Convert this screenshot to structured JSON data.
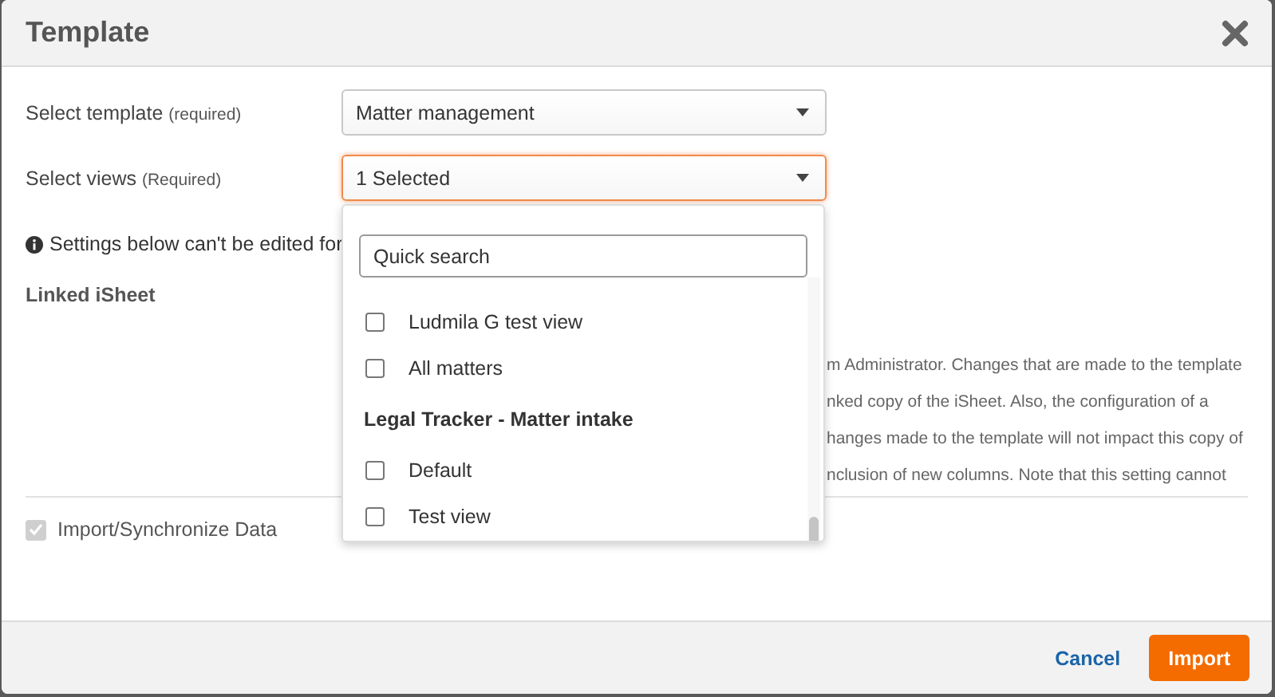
{
  "dialog": {
    "title": "Template"
  },
  "fields": [
    {
      "label": "Select template",
      "hint": "(required)",
      "value": "Matter management",
      "focused": false
    },
    {
      "label": "Select views",
      "hint": "(Required)",
      "value": "1 Selected",
      "focused": true
    }
  ],
  "views_menu": {
    "search_placeholder": "Quick search",
    "items": [
      {
        "kind": "option",
        "label": "Ludmila G test view",
        "checked": false
      },
      {
        "kind": "option",
        "label": "All matters",
        "checked": false
      },
      {
        "kind": "group",
        "label": "Legal Tracker - Matter intake"
      },
      {
        "kind": "option",
        "label": "Default",
        "checked": false
      },
      {
        "kind": "option",
        "label": "Test view",
        "checked": false
      }
    ]
  },
  "notice": "Settings below can't be edited for",
  "linked_isheet": {
    "label": "Linked iSheet",
    "description_lines": [
      "m Administrator. Changes that are made to the template",
      "nked copy of the iSheet. Also, the configuration of a",
      "hanges made to the template will not impact this copy of",
      "nclusion of new columns. Note that this setting cannot"
    ]
  },
  "import_sync": {
    "label": "Import/Synchronize Data",
    "checked": true,
    "disabled": true
  },
  "buttons": [
    {
      "kind": "link",
      "label": "Cancel"
    },
    {
      "kind": "primary",
      "label": "Import"
    }
  ]
}
